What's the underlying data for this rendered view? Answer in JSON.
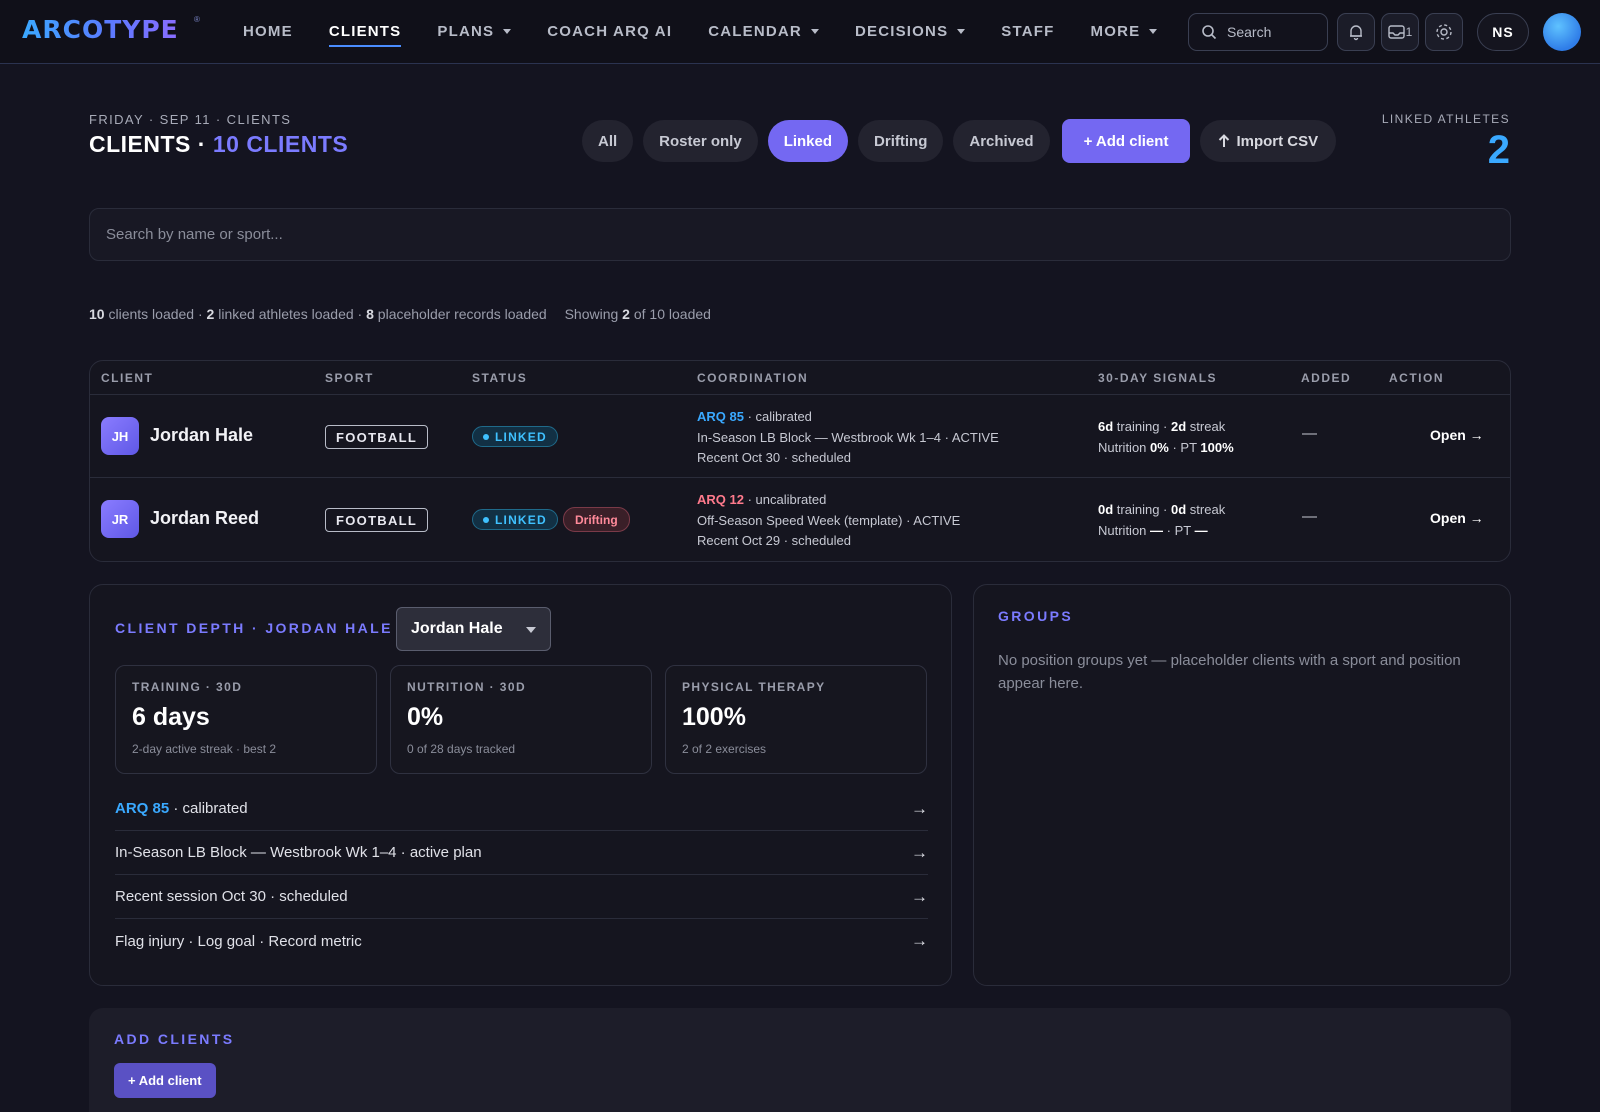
{
  "app": {
    "logo": "ARCOTYPE",
    "logo_mark": "®"
  },
  "nav": {
    "links": [
      {
        "label": "HOME",
        "dropdown": false,
        "active": false
      },
      {
        "label": "CLIENTS",
        "dropdown": false,
        "active": true
      },
      {
        "label": "PLANS",
        "dropdown": true,
        "active": false
      },
      {
        "label": "COACH ARQ AI",
        "dropdown": false,
        "active": false
      },
      {
        "label": "CALENDAR",
        "dropdown": true,
        "active": false
      },
      {
        "label": "DECISIONS",
        "dropdown": true,
        "active": false
      },
      {
        "label": "STAFF",
        "dropdown": false,
        "active": false
      },
      {
        "label": "MORE",
        "dropdown": true,
        "active": false
      }
    ],
    "search_placeholder": "Search",
    "inbox_count": "1",
    "user_initials": "NS",
    "icons": [
      "search-icon",
      "bell-icon",
      "inbox-icon",
      "gear-icon"
    ]
  },
  "header": {
    "breadcrumb": "FRIDAY · SEP 11 · CLIENTS",
    "title": "CLIENTS ·",
    "title_count": "10 CLIENTS",
    "filters": [
      {
        "label": "All",
        "active": false
      },
      {
        "label": "Roster only",
        "active": false
      },
      {
        "label": "Linked",
        "active": true
      },
      {
        "label": "Drifting",
        "active": false
      },
      {
        "label": "Archived",
        "active": false
      }
    ],
    "add_client_label": "+ Add client",
    "import_csv_label": "Import CSV",
    "linked_athletes_label": "LINKED ATHLETES",
    "linked_athletes_value": "2"
  },
  "search": {
    "placeholder": "Search by name or sport...",
    "value": ""
  },
  "stats": {
    "clients_loaded": "10",
    "clients_loaded_text": "clients loaded ·",
    "linked_loaded": "2",
    "linked_loaded_text": "linked athletes loaded ·",
    "placeholder_loaded": "8",
    "placeholder_loaded_text": "placeholder records loaded",
    "showing_prefix": "Showing",
    "showing_count": "2",
    "showing_suffix": "of 10 loaded"
  },
  "table": {
    "columns": [
      "CLIENT",
      "SPORT",
      "STATUS",
      "COORDINATION",
      "30-DAY SIGNALS",
      "ADDED",
      "ACTION"
    ],
    "rows": [
      {
        "initials": "JH",
        "name": "Jordan Hale",
        "sport": "FOOTBALL",
        "status": "LINKED",
        "drifting": "",
        "arq": "ARQ 85",
        "arq_state": "· calibrated",
        "plan": "In-Season LB Block — Westbrook Wk 1–4 · ACTIVE",
        "recent": "Recent Oct 30 · scheduled",
        "training_days": "6d",
        "training_text": "training ·",
        "streak": "2d",
        "streak_text": "streak",
        "nutrition_label": "Nutrition",
        "nutrition": "0%",
        "pt_label": "· PT",
        "pt": "100%",
        "added": "—",
        "action": "Open →"
      },
      {
        "initials": "JR",
        "name": "Jordan Reed",
        "sport": "FOOTBALL",
        "status": "LINKED",
        "drifting": "Drifting",
        "arq": "ARQ 12",
        "arq_state": "· uncalibrated",
        "plan": "Off-Season Speed Week (template) · ACTIVE",
        "recent": "Recent Oct 29 · scheduled",
        "training_days": "0d",
        "training_text": "training ·",
        "streak": "0d",
        "streak_text": "streak",
        "nutrition_label": "Nutrition",
        "nutrition": "—",
        "pt_label": "· PT",
        "pt": "—",
        "added": "—",
        "action": "Open →"
      }
    ]
  },
  "depth": {
    "title": "CLIENT DEPTH · JORDAN HALE",
    "selected_client": "Jordan Hale",
    "metrics": [
      {
        "label": "TRAINING · 30D",
        "value": "6 days",
        "sub": "2-day active streak · best 2"
      },
      {
        "label": "NUTRITION · 30D",
        "value": "0%",
        "sub": "0 of 28 days tracked"
      },
      {
        "label": "PHYSICAL THERAPY",
        "value": "100%",
        "sub": "2 of 2 exercises"
      }
    ],
    "arq": "ARQ 85",
    "arq_state": "· calibrated",
    "plan_link": "In-Season LB Block — Westbrook Wk 1–4 · active plan",
    "session_link": "Recent session Oct 30 · scheduled",
    "actions_link": "Flag injury · Log goal · Record metric",
    "arrow": "→"
  },
  "groups": {
    "title": "GROUPS",
    "empty_text": "No position groups yet — placeholder clients with a sport and position appear here."
  },
  "add_clients": {
    "title": "ADD CLIENTS",
    "button_label": "+ Add client"
  },
  "colors": {
    "accent": "#7468f2",
    "link_blue": "#3aa9ff",
    "badge_cyan": "#3fc1ff",
    "danger": "#ff7a8c",
    "background": "#141420"
  }
}
